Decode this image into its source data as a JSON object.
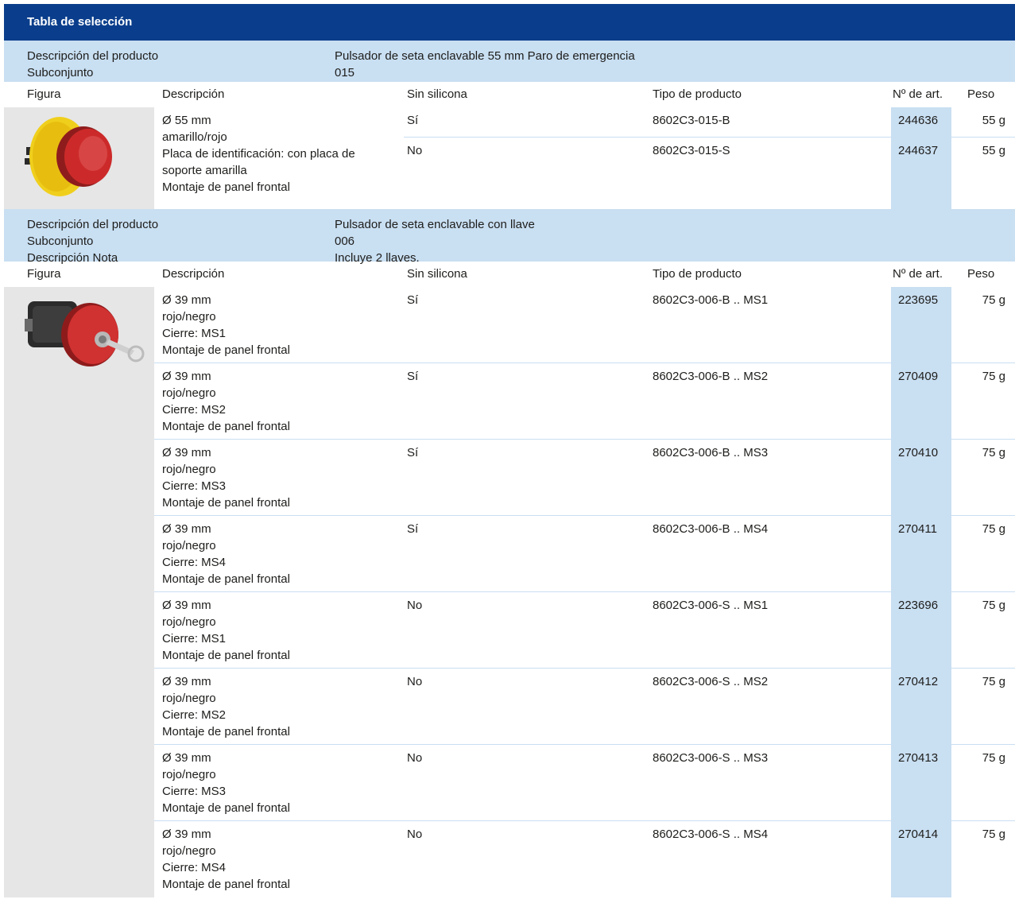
{
  "title": "Tabla de selección",
  "headers": {
    "figura": "Figura",
    "descripcion": "Descripción",
    "sin_silicona": "Sin silicona",
    "tipo": "Tipo de producto",
    "art": "Nº de art.",
    "peso": "Peso"
  },
  "section1": {
    "label_desc": "Descripción del producto",
    "label_sub": "Subconjunto",
    "value_desc": "Pulsador de seta enclavable 55 mm Paro de emergencia",
    "value_sub": "015",
    "description_lines": [
      "Ø 55 mm",
      "amarillo/rojo",
      "Placa de identificación: con placa de",
      "soporte amarilla",
      "Montaje de panel frontal"
    ],
    "rows": [
      {
        "sil": "Sí",
        "type": "8602C3-015-B",
        "art": "244636",
        "peso": "55 g"
      },
      {
        "sil": "No",
        "type": "8602C3-015-S",
        "art": "244637",
        "peso": "55 g"
      }
    ]
  },
  "section2": {
    "label_desc": "Descripción del producto",
    "label_sub": "Subconjunto",
    "label_note": "Descripción Nota",
    "value_desc": "Pulsador de seta enclavable con llave",
    "value_sub": "006",
    "value_note": "Incluye 2 llaves.",
    "rows": [
      {
        "d1": "Ø 39 mm",
        "d2": "rojo/negro",
        "d3": "Cierre: MS1",
        "d4": "Montaje de panel frontal",
        "sil": "Sí",
        "type": "8602C3-006-B .. MS1",
        "art": "223695",
        "peso": "75 g"
      },
      {
        "d1": "Ø 39 mm",
        "d2": "rojo/negro",
        "d3": "Cierre: MS2",
        "d4": "Montaje de panel frontal",
        "sil": "Sí",
        "type": "8602C3-006-B .. MS2",
        "art": "270409",
        "peso": "75 g"
      },
      {
        "d1": "Ø 39 mm",
        "d2": "rojo/negro",
        "d3": "Cierre: MS3",
        "d4": "Montaje de panel frontal",
        "sil": "Sí",
        "type": "8602C3-006-B .. MS3",
        "art": "270410",
        "peso": "75 g"
      },
      {
        "d1": "Ø 39 mm",
        "d2": "rojo/negro",
        "d3": "Cierre: MS4",
        "d4": "Montaje de panel frontal",
        "sil": "Sí",
        "type": "8602C3-006-B .. MS4",
        "art": "270411",
        "peso": "75 g"
      },
      {
        "d1": "Ø 39 mm",
        "d2": "rojo/negro",
        "d3": "Cierre: MS1",
        "d4": "Montaje de panel frontal",
        "sil": "No",
        "type": "8602C3-006-S .. MS1",
        "art": "223696",
        "peso": "75 g"
      },
      {
        "d1": "Ø 39 mm",
        "d2": "rojo/negro",
        "d3": "Cierre: MS2",
        "d4": "Montaje de panel frontal",
        "sil": "No",
        "type": "8602C3-006-S .. MS2",
        "art": "270412",
        "peso": "75 g"
      },
      {
        "d1": "Ø 39 mm",
        "d2": "rojo/negro",
        "d3": "Cierre: MS3",
        "d4": "Montaje de panel frontal",
        "sil": "No",
        "type": "8602C3-006-S .. MS3",
        "art": "270413",
        "peso": "75 g"
      },
      {
        "d1": "Ø 39 mm",
        "d2": "rojo/negro",
        "d3": "Cierre: MS4",
        "d4": "Montaje de panel frontal",
        "sil": "No",
        "type": "8602C3-006-S .. MS4",
        "art": "270414",
        "peso": "75 g"
      }
    ]
  },
  "colors": {
    "title_bar": "#0a3e8c",
    "section_bg": "#c9dff2",
    "figure_bg": "#e6e6e6"
  },
  "icons": {
    "product1": "emergency-stop-button-yellow-red-icon",
    "product2": "key-lock-mushroom-button-icon"
  }
}
